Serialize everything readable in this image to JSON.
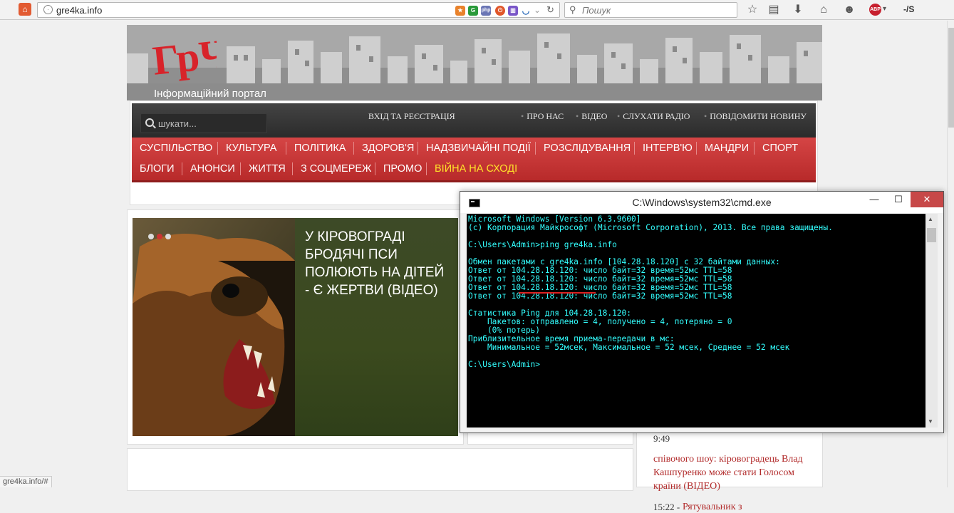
{
  "browser": {
    "url": "gre4ka.info",
    "search_placeholder": "Пошук",
    "addon_labels": [
      "G",
      "php"
    ],
    "adblock_label": "ABP",
    "devtools_label": "-/S",
    "status_url": "gre4ka.info/#"
  },
  "site": {
    "tagline": "Інформаційний портал",
    "search_placeholder": "шукати...",
    "login": "ВХІД ТА РЕЄСТРАЦІЯ",
    "top_links": [
      "ПРО НАС",
      "ВІДЕО",
      "СЛУХАТИ РАДІО",
      "ПОВІДОМИТИ НОВИНУ"
    ],
    "categories_row1": [
      "СУСПІЛЬСТВО",
      "КУЛЬТУРА",
      "ПОЛІТИКА",
      "ЗДОРОВ'Я",
      "НАДЗВИЧАЙНІ ПОДІЇ",
      "РОЗСЛІДУВАННЯ",
      "ІНТЕРВ'Ю",
      "МАНДРИ",
      "СПОРТ"
    ],
    "categories_row2": [
      "БЛОГИ",
      "АНОНСИ",
      "ЖИТТЯ",
      "З СОЦМЕРЕЖ",
      "ПРОМО",
      "ВІЙНА НА СХОДІ"
    ],
    "slide_headline": "У КІРОВОГРАДІ БРОДЯЧІ ПСИ ПОЛЮЮТЬ НА ДІТЕЙ - Є ЖЕРТВИ (ВІДЕО)",
    "news": {
      "time1": "9:49",
      "item1": "співочого шоу: кіровоградець Влад Кашпуренко може стати Голосом країни (ВІДЕО)",
      "time2": "15:22 -",
      "item2": "Рятувальник з"
    }
  },
  "cmd": {
    "title": "C:\\Windows\\system32\\cmd.exe",
    "minimize": "—",
    "maximize": "☐",
    "close": "✕",
    "lines": [
      "Microsoft Windows [Version 6.3.9600]",
      "(c) Корпорация Майкрософт (Microsoft Corporation), 2013. Все права защищены.",
      "",
      "C:\\Users\\Admin>ping gre4ka.info",
      "",
      "Обмен пакетами с gre4ka.info [104.28.18.120] с 32 байтами данных:",
      "Ответ от 104.28.18.120: число байт=32 время=52мс TTL=58",
      "Ответ от 104.28.18.120: число байт=32 время=52мс TTL=58",
      "Ответ от 104.28.18.120: число байт=32 время=52мс TTL=58",
      "Ответ от 104.28.18.120: число байт=32 время=52мс TTL=58",
      "",
      "Статистика Ping для 104.28.18.120:",
      "    Пакетов: отправлено = 4, получено = 4, потеряно = 0",
      "    (0% потерь)",
      "Приблизительное время приема-передачи в мс:",
      "    Минимальное = 52мсек, Максимальное = 52 мсек, Среднее = 52 мсек",
      "",
      "C:\\Users\\Admin>"
    ]
  },
  "colors": {
    "nav_red": "#c93636",
    "console_text": "#33ffff",
    "highlight": "#ffe22a"
  }
}
